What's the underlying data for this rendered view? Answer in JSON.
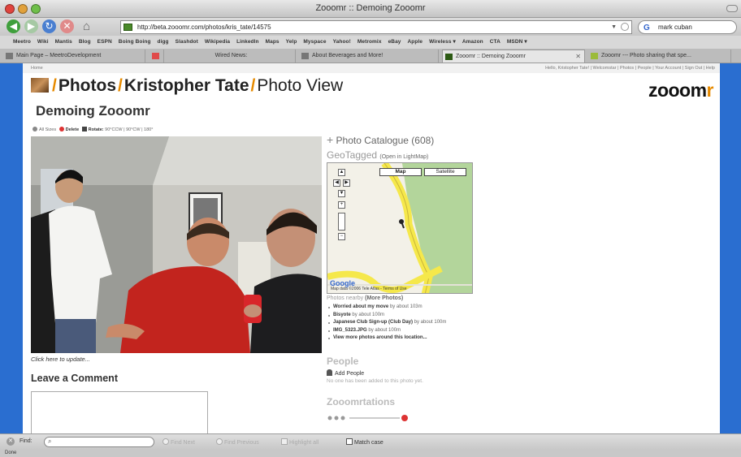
{
  "window": {
    "title": "Zooomr :: Demoing Zooomr"
  },
  "nav": {
    "url": "http://beta.zooomr.com/photos/kris_tate/14575",
    "search_value": "mark cuban"
  },
  "bookmarks": [
    "Meetro",
    "Wiki",
    "Mantis",
    "Blog",
    "ESPN",
    "Boing Boing",
    "digg",
    "Slashdot",
    "Wikipedia",
    "LinkedIn",
    "Maps",
    "Yelp",
    "Myspace",
    "Yahoo!",
    "Metromix",
    "eBay",
    "Apple",
    "Wireless ▾",
    "Amazon",
    "CTA",
    "MSDN ▾"
  ],
  "tabs": [
    {
      "label": "Main Page – MeetroDevelopment"
    },
    {
      "label": ""
    },
    {
      "label": "Wired News:"
    },
    {
      "label": "About Beverages and More!"
    },
    {
      "label": "Zooomr :: Demoing Zooomr"
    },
    {
      "label": "Zooomr --- Photo sharing that spe..."
    }
  ],
  "page": {
    "home_link": "Home",
    "user_links": "Hello, Kristopher Tate! | Welcomstar | Photos | People | Your Account | Sign Out | Help",
    "breadcrumb": {
      "part1": "Photos",
      "part2": "Kristopher Tate",
      "part3": "Photo View"
    },
    "logo_main": "zooom",
    "logo_r": "r",
    "photo_title": "Demoing Zooomr",
    "toolbar": {
      "all_sizes": "All Sizes",
      "delete": "Delete",
      "rotate": "Rotate:",
      "rotate_opts": "90°CCW | 90°CW | 180°"
    },
    "caption": "Click here to update...",
    "leave_comment": "Leave a Comment",
    "catalogue": "Photo Catalogue (608)",
    "geotagged": "GeoTagged",
    "open_lightmap": "(Open in LightMap)",
    "map": {
      "btn_map": "Map",
      "btn_satellite": "Satellite",
      "copyright": "Map data ©2006 Tele Atlas - Terms of Use",
      "google": "Google"
    },
    "nearby_label": "Photos nearby",
    "more_photos": "(More Photos)",
    "nearby": [
      {
        "title": "Worried about my move",
        "dist": " by about 103m"
      },
      {
        "title": "Bisyote",
        "dist": " by about 100m"
      },
      {
        "title": "Japanese Club Sign-up (Club Day)",
        "dist": " by about 100m"
      },
      {
        "title": "IMG_5323.JPG",
        "dist": " by about 100m"
      },
      {
        "title": "View more photos around this location...",
        "dist": ""
      }
    ],
    "people_heading": "People",
    "add_people": "Add People",
    "no_people": "No one has been added to this photo yet.",
    "zooomrtations": "Zooomrtations"
  },
  "findbar": {
    "label": "Find:",
    "value": "",
    "next": "Find Next",
    "prev": "Find Previous",
    "highlight": "Highlight all",
    "match": "Match case"
  },
  "status": "Done"
}
